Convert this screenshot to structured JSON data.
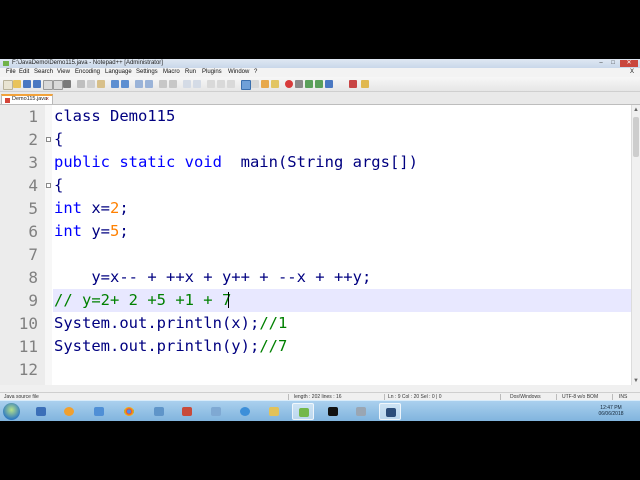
{
  "window": {
    "title": "F:\\JavaDemo\\Demo115.java - Notepad++ [Administrator]",
    "controls": {
      "minimize": "–",
      "maximize": "□",
      "close": "✕"
    }
  },
  "menu": {
    "items": [
      "File",
      "Edit",
      "Search",
      "View",
      "Encoding",
      "Language",
      "Settings",
      "Macro",
      "Run",
      "Plugins",
      "Window",
      "?"
    ],
    "close_doc": "X"
  },
  "tab": {
    "label": "Demo115.java",
    "close": "x"
  },
  "editor": {
    "line_numbers": [
      "1",
      "2",
      "3",
      "4",
      "5",
      "6",
      "7",
      "8",
      "9",
      "10",
      "11",
      "12"
    ],
    "fold_lines": [
      2,
      4
    ],
    "highlighted_line": 9,
    "lines": [
      {
        "segments": [
          {
            "t": "class Demo115",
            "c": "kw-class"
          }
        ]
      },
      {
        "segments": [
          {
            "t": "{",
            "c": "op"
          }
        ]
      },
      {
        "segments": [
          {
            "t": "public static void",
            "c": "kw"
          },
          {
            "t": "  main(String args[])",
            "c": "op"
          }
        ]
      },
      {
        "segments": [
          {
            "t": "{",
            "c": "op"
          }
        ]
      },
      {
        "segments": [
          {
            "t": "int",
            "c": "kw"
          },
          {
            "t": " x=",
            "c": "op"
          },
          {
            "t": "2",
            "c": "num"
          },
          {
            "t": ";",
            "c": "op"
          }
        ]
      },
      {
        "segments": [
          {
            "t": "int",
            "c": "kw"
          },
          {
            "t": " y=",
            "c": "op"
          },
          {
            "t": "5",
            "c": "num"
          },
          {
            "t": ";",
            "c": "op"
          }
        ]
      },
      {
        "segments": []
      },
      {
        "segments": [
          {
            "t": "    y=x-- + ++x + y++ + --x + ++y;",
            "c": "op"
          }
        ]
      },
      {
        "segments": [
          {
            "t": "// y=2+ 2 +5 +1 + 7",
            "c": "cmt"
          }
        ]
      },
      {
        "segments": [
          {
            "t": "System.out.println(x);",
            "c": "op"
          },
          {
            "t": "//1",
            "c": "cmt"
          }
        ]
      },
      {
        "segments": [
          {
            "t": "System.out.println(y);",
            "c": "op"
          },
          {
            "t": "//7",
            "c": "cmt"
          }
        ]
      },
      {
        "segments": []
      }
    ]
  },
  "status": {
    "file_type": "Java source file",
    "length": "length : 202   lines : 16",
    "position": "Ln : 9   Col : 20   Sel : 0 | 0",
    "eol": "Dos\\Windows",
    "encoding": "UTF-8 w/o BOM",
    "mode": "INS"
  },
  "taskbar": {
    "clock_time": "12:47 PM",
    "clock_date": "06/06/2018"
  },
  "colors": {
    "keyword": "#0000ff",
    "number": "#ff8000",
    "operator": "#000080",
    "comment": "#008000",
    "line_highlight": "#e8e8ff"
  }
}
